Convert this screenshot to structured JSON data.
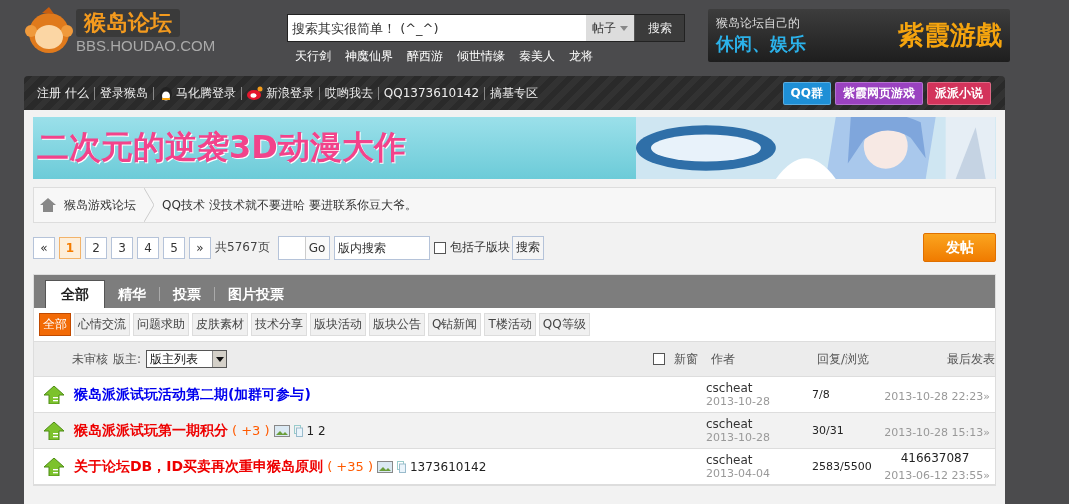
{
  "header": {
    "logo_title": "猴岛论坛",
    "logo_url": "BBS.HOUDAO.COM",
    "search": {
      "placeholder": "搜索其实很简单！ (^_^)",
      "scope": "帖子",
      "button": "搜索"
    },
    "hot_links": [
      "天行剑",
      "神魔仙界",
      "醉西游",
      "倾世情缘",
      "秦美人",
      "龙将"
    ],
    "ad": {
      "line1": "猴岛论坛自己的",
      "line2": "休闲、娱乐",
      "brand": "紫霞游戲"
    }
  },
  "nav": {
    "links": [
      {
        "label": "注册 什么",
        "kind": "text"
      },
      {
        "label": "登录猴岛",
        "kind": "text"
      },
      {
        "label": "马化腾登录",
        "kind": "qq"
      },
      {
        "label": "新浪登录",
        "kind": "weibo"
      },
      {
        "label": "哎哟我去",
        "kind": "text"
      },
      {
        "label": "QQ1373610142",
        "kind": "text"
      },
      {
        "label": "搞基专区",
        "kind": "text"
      }
    ],
    "buttons": [
      {
        "label": "QQ群",
        "color": "#1e8fd6"
      },
      {
        "label": "紫霞网页游戏",
        "color": "#9a42c0"
      },
      {
        "label": "派派小说",
        "color": "#d3335b"
      }
    ]
  },
  "banner": {
    "headline": "二次元的逆袭3D动漫大作"
  },
  "breadcrumb": [
    "猴岛游戏论坛",
    "QQ技术 没技术就不要进哈  要进联系你豆大爷。"
  ],
  "pagination": {
    "prev": "«",
    "pages": [
      {
        "label": "1",
        "selected": true
      },
      {
        "label": "2",
        "selected": false
      },
      {
        "label": "3",
        "selected": false
      },
      {
        "label": "4",
        "selected": false
      },
      {
        "label": "5",
        "selected": false
      }
    ],
    "next": "»",
    "total": "共5767页",
    "go": "Go",
    "search_placeholder": "版内搜索",
    "include_sub": {
      "label": "包括子版块",
      "checked": false
    },
    "search_button": "搜索",
    "post_button": "发帖"
  },
  "tabs": [
    {
      "label": "全部",
      "selected": true
    },
    {
      "label": "精华",
      "selected": false
    },
    {
      "label": "投票",
      "selected": false
    },
    {
      "label": "图片投票",
      "selected": false
    }
  ],
  "filters": [
    {
      "label": "全部",
      "selected": true
    },
    {
      "label": "心情交流",
      "selected": false
    },
    {
      "label": "问题求助",
      "selected": false
    },
    {
      "label": "皮肤素材",
      "selected": false
    },
    {
      "label": "技术分享",
      "selected": false
    },
    {
      "label": "版块活动",
      "selected": false
    },
    {
      "label": "版块公告",
      "selected": false
    },
    {
      "label": "Q钻新闻",
      "selected": false
    },
    {
      "label": "T楼活动",
      "selected": false
    },
    {
      "label": "QQ等级",
      "selected": false
    }
  ],
  "table": {
    "unreviewed": "未审核",
    "moderator_label": "版主:",
    "moderator_select": "版主列表",
    "new_window": {
      "label": "新窗",
      "checked": false
    },
    "columns": [
      "作者",
      "回复/浏览",
      "最后发表"
    ],
    "rows": [
      {
        "title": "猴岛派派试玩活动第二期(加群可参与)",
        "color": "#0000ee",
        "author": "cscheat",
        "date": "2013-10-28",
        "stats": "7/8",
        "last_time": "2013-10-28 22:23»"
      },
      {
        "title": "猴岛派派试玩第一期积分",
        "color": "#ee0000",
        "score": "( +3 )",
        "has_image": true,
        "has_attachment": true,
        "suffix": "1 2",
        "author": "cscheat",
        "date": "2013-10-28",
        "stats": "30/31",
        "last_time": "2013-10-28 15:13»"
      },
      {
        "title": "关于论坛DB，ID买卖再次重申猴岛原则",
        "color": "#ee0000",
        "score": "( +35 )",
        "has_image": true,
        "has_attachment": true,
        "suffix": "1373610142",
        "author": "cscheat",
        "date": "2013-04-04",
        "stats": "2583/5500",
        "last_by": "416637087",
        "last_time": "2013-06-12 23:55»"
      }
    ]
  }
}
